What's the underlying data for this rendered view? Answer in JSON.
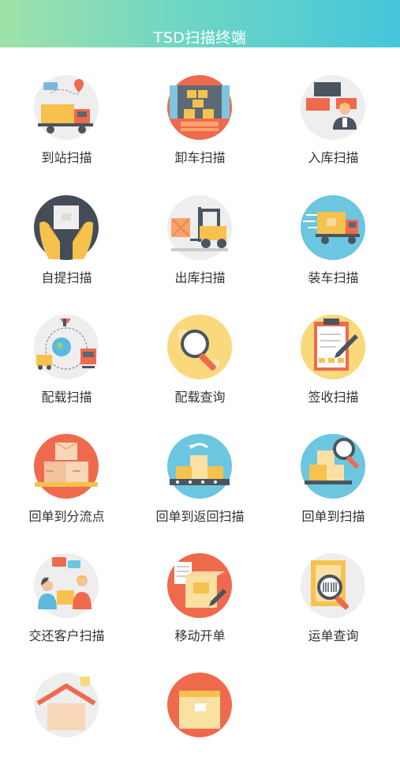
{
  "header": {
    "title": "TSD扫描终端"
  },
  "tiles": [
    {
      "label": "到站扫描",
      "icon": "truck-arrival-icon"
    },
    {
      "label": "卸车扫描",
      "icon": "unload-truck-icon"
    },
    {
      "label": "入库扫描",
      "icon": "warehouse-worker-icon"
    },
    {
      "label": "自提扫描",
      "icon": "hands-package-icon"
    },
    {
      "label": "出库扫描",
      "icon": "forklift-icon"
    },
    {
      "label": "装车扫描",
      "icon": "loading-truck-icon"
    },
    {
      "label": "配载扫描",
      "icon": "global-transport-icon"
    },
    {
      "label": "配载查询",
      "icon": "map-search-icon"
    },
    {
      "label": "签收扫描",
      "icon": "clipboard-sign-icon"
    },
    {
      "label": "回单到分流点",
      "icon": "boxes-stack-icon"
    },
    {
      "label": "回单到返回扫描",
      "icon": "conveyor-boxes-icon"
    },
    {
      "label": "回单到扫描",
      "icon": "boxes-search-icon"
    },
    {
      "label": "交还客户扫描",
      "icon": "customer-handover-icon"
    },
    {
      "label": "移动开单",
      "icon": "mobile-order-icon"
    },
    {
      "label": "运单查询",
      "icon": "waybill-search-icon"
    },
    {
      "label": "",
      "icon": "home-delivery-icon"
    },
    {
      "label": "",
      "icon": "package-icon"
    }
  ]
}
